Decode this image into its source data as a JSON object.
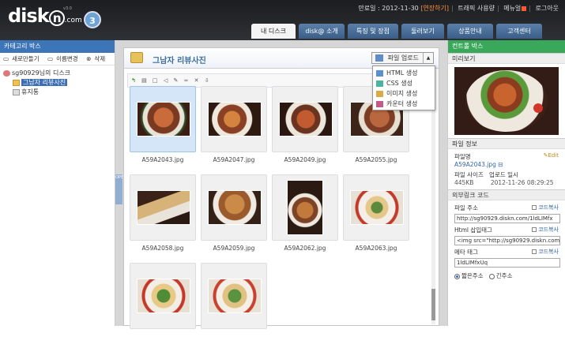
{
  "logo": {
    "text": "disk",
    "letter": "n",
    "suffix": ".com",
    "version": "v3.0",
    "badge": "3"
  },
  "topinfo": {
    "expire": "만료일 : 2012-11-30",
    "extend": "[연장하기]",
    "trial": "트래픽 사용량",
    "menu": "메뉴얼",
    "logout": "로그아웃"
  },
  "tabs": [
    {
      "label": "내 디스크"
    },
    {
      "label": "disk@ 소개"
    },
    {
      "label": "특징 및 장점"
    },
    {
      "label": "둘러보기"
    },
    {
      "label": "상품안내"
    },
    {
      "label": "고객센터"
    }
  ],
  "left": {
    "header": "카테고리 박스",
    "tools": [
      "새로만들기",
      "이름변경",
      "삭제"
    ],
    "disk_label": "sg90929님의 디스크",
    "folder": "그남자 리뷰사진",
    "trash": "휴지통"
  },
  "center": {
    "folder_title": "그남자 리뷰사진",
    "upload_label": "파일 업로드",
    "toolbar_right": "파일",
    "open_tab": "OPEN",
    "dropdown": [
      "HTML 생성",
      "CSS 생성",
      "이미지 생성",
      "카운터 생성"
    ],
    "files": [
      {
        "name": "A59A2043.jpg",
        "selected": true
      },
      {
        "name": "A59A2047.jpg"
      },
      {
        "name": "A59A2049.jpg"
      },
      {
        "name": "A59A2055.jpg"
      },
      {
        "name": "A59A2058.jpg"
      },
      {
        "name": "A59A2059.jpg"
      },
      {
        "name": "A59A2062.jpg"
      },
      {
        "name": "A59A2063.jpg"
      },
      {
        "name": ""
      },
      {
        "name": ""
      }
    ]
  },
  "right": {
    "header": "컨트롤 박스",
    "preview_label": "미리보기",
    "fileinfo_label": "파일 정보",
    "filename_label": "파일명",
    "edit_label": "Edit",
    "filename": "A59A2043.jpg",
    "size_label": "파일 사이즈",
    "upload_date_label": "업로드 일시",
    "size": "445KB",
    "date": "2012-11-26 08:29:25",
    "external_label": "외부링크 코드",
    "file_addr_label": "파일 주소",
    "copy_label": "코드복사",
    "file_addr": "http://sg90929.diskn.com/1ldLIMfx",
    "html_tag_label": "Html 삽입태그",
    "html_tag": "<img src=\"http://sg90929.diskn.com",
    "meta_tag_label": "메타 태그",
    "meta_tag": "1ldLIMfxUq",
    "short_label": "짧은주소",
    "full_label": "긴주소"
  }
}
